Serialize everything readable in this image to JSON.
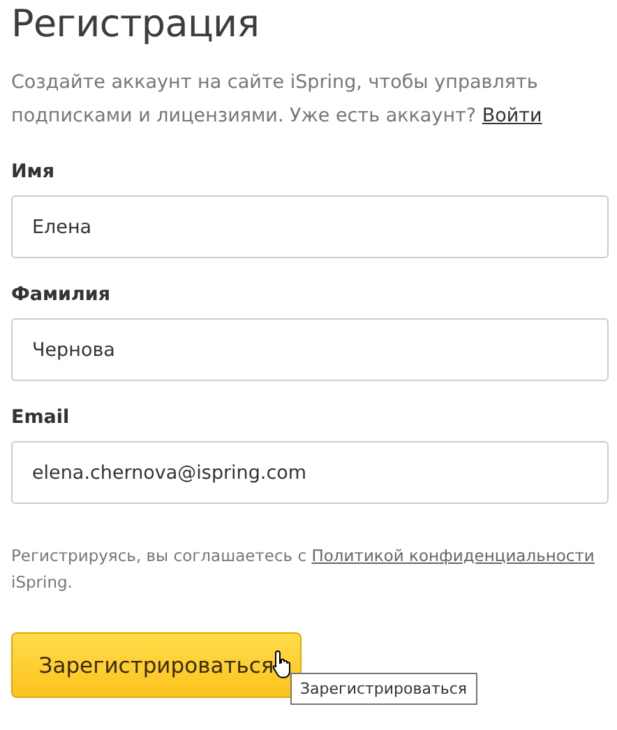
{
  "title": "Регистрация",
  "intro": {
    "text": "Создайте аккаунт на сайте iSpring, чтобы управлять подписками и лицензиями. Уже есть аккаунт?",
    "link": "Войти"
  },
  "fields": [
    {
      "label": "Имя",
      "value": "Елена"
    },
    {
      "label": "Фамилия",
      "value": "Чернова"
    },
    {
      "label": "Email",
      "value": "elena.chernova@ispring.com"
    }
  ],
  "terms": {
    "text": "Регистрируясь, вы соглашаетесь с",
    "link": "Политикой конфиденциальности",
    "after": "iSpring."
  },
  "submit": {
    "label": "Зарегистрироваться"
  },
  "tooltip": "Зарегистрироваться"
}
